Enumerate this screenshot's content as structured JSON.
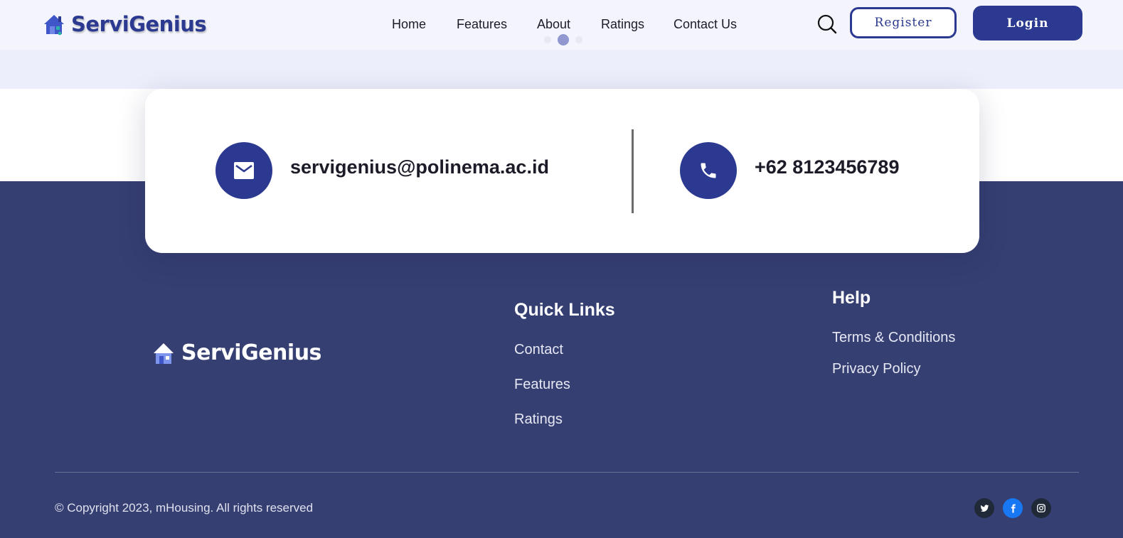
{
  "header": {
    "brand_name": "ServiGenius",
    "nav": [
      {
        "label": "Home"
      },
      {
        "label": "Features"
      },
      {
        "label": "About"
      },
      {
        "label": "Ratings"
      },
      {
        "label": "Contact Us"
      }
    ],
    "carousel": {
      "slides": 3,
      "active_index": 1
    },
    "register_label": "Register",
    "login_label": "Login"
  },
  "contact": {
    "email": "servigenius@polinema.ac.id",
    "phone": "+62 8123456789",
    "email_icon": "mail-icon",
    "phone_icon": "phone-icon"
  },
  "footer": {
    "brand_name": "ServiGenius",
    "quick_links": {
      "title": "Quick Links",
      "items": [
        "Contact",
        "Features",
        "Ratings"
      ]
    },
    "help": {
      "title": "Help",
      "items": [
        "Terms & Conditions",
        "Privacy Policy"
      ]
    },
    "copyright": "© Copyright 2023, mHousing. All rights reserved",
    "social": [
      {
        "icon": "twitter-icon",
        "color": "#1f2937"
      },
      {
        "icon": "facebook-icon",
        "color": "#1877f2"
      },
      {
        "icon": "instagram-icon",
        "color": "#1f2937"
      }
    ]
  },
  "colors": {
    "brand": "#2b3990",
    "footer_bg": "#363f72",
    "header_bg": "#f4f5fc",
    "band_bg": "#eceefb"
  }
}
